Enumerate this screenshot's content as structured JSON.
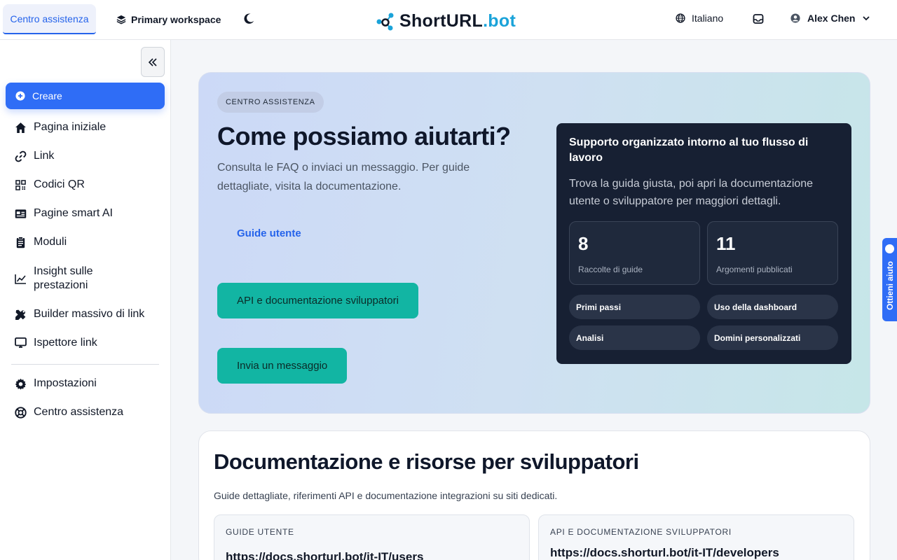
{
  "header": {
    "help_tab": "Centro assistenza",
    "workspace": "Primary workspace",
    "logo_main": "ShortURL",
    "logo_accent": ".bot",
    "language": "Italiano",
    "user_name": "Alex Chen"
  },
  "sidebar": {
    "create_label": "Creare",
    "items": [
      {
        "label": "Pagina iniziale",
        "icon": "home-icon"
      },
      {
        "label": "Link",
        "icon": "link-icon"
      },
      {
        "label": "Codici QR",
        "icon": "qr-code-icon"
      },
      {
        "label": "Pagine smart AI",
        "icon": "id-card-icon"
      },
      {
        "label": "Moduli",
        "icon": "clipboard-icon"
      },
      {
        "label": "Insight sulle prestazioni",
        "icon": "chart-line-icon"
      },
      {
        "label": "Builder massivo di link",
        "icon": "tools-icon"
      },
      {
        "label": "Ispettore link",
        "icon": "monitor-icon"
      }
    ],
    "bottom_items": [
      {
        "label": "Impostazioni",
        "icon": "gear-icon"
      },
      {
        "label": "Centro assistenza",
        "icon": "lifebuoy-icon"
      }
    ]
  },
  "hero": {
    "badge": "CENTRO ASSISTENZA",
    "title": "Come possiamo aiutarti?",
    "subtitle": "Consulta le FAQ o inviaci un messaggio. Per guide dettagliate, visita la documentazione.",
    "user_guides_link": "Guide utente",
    "api_docs_button": "API e documentazione sviluppatori",
    "send_message_button": "Invia un messaggio",
    "panel": {
      "title": "Supporto organizzato intorno al tuo flusso di lavoro",
      "subtitle": "Trova la guida giusta, poi apri la documentazione utente o sviluppatore per maggiori dettagli.",
      "stats": [
        {
          "value": "8",
          "caption": "Raccolte di guide"
        },
        {
          "value": "11",
          "caption": "Argomenti pubblicati"
        }
      ],
      "topics": [
        "Primi passi",
        "Uso della dashboard",
        "Analisi",
        "Domini personalizzati"
      ]
    }
  },
  "docs": {
    "title": "Documentazione e risorse per sviluppatori",
    "subtitle": "Guide dettagliate, riferimenti API e documentazione integrazioni su siti dedicati.",
    "boxes": [
      {
        "label": "GUIDE UTENTE",
        "url": "https://docs.shorturl.bot/it-IT/users"
      },
      {
        "label": "API E DOCUMENTAZIONE SVILUPPATORI",
        "url": "https://docs.shorturl.bot/it-IT/developers"
      }
    ]
  },
  "help_float": "Ottieni aiuto",
  "colors": {
    "primary": "#2f6df6",
    "teal": "#12b5a3",
    "dark_panel": "#172033",
    "logo_accent": "#1aa3d9"
  }
}
